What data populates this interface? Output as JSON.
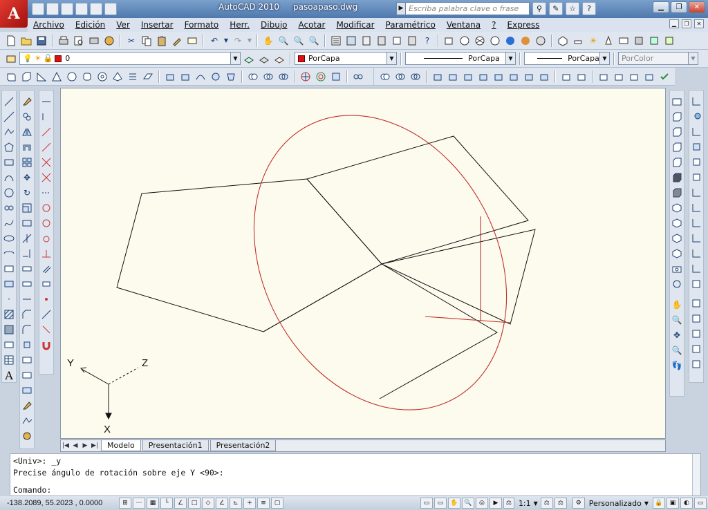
{
  "app": {
    "name": "AutoCAD 2010",
    "file": "pasoapaso.dwg",
    "logo_letter": "A"
  },
  "search": {
    "placeholder": "Escriba palabra clave o frase"
  },
  "menu": [
    "Archivo",
    "Edición",
    "Ver",
    "Insertar",
    "Formato",
    "Herr.",
    "Dibujo",
    "Acotar",
    "Modificar",
    "Paramétrico",
    "Ventana",
    "?",
    "Express"
  ],
  "layer": {
    "name": "0",
    "color": "#e01010"
  },
  "properties": {
    "color": "PorCapa",
    "linetype": "PorCapa",
    "lineweight": "PorCapa",
    "plotstyle": "PorColor"
  },
  "ucs": {
    "x_label": "X",
    "y_label": "Y",
    "z_label": "Z"
  },
  "tabs": [
    "Modelo",
    "Presentación1",
    "Presentación2"
  ],
  "command": {
    "line1": "<Univ>: _y",
    "line2": "Precise ángulo de rotación sobre eje Y <90>:",
    "line3": "Comando:"
  },
  "status": {
    "coords": "-138.2089, 55.2023 , 0.0000",
    "scale": "1:1",
    "workspace": "Personalizado"
  },
  "colors": {
    "canvas_bg": "#fdfbee",
    "drawing_line": "#111111",
    "selection_red": "#c0302a",
    "accent": "#e23b32"
  }
}
